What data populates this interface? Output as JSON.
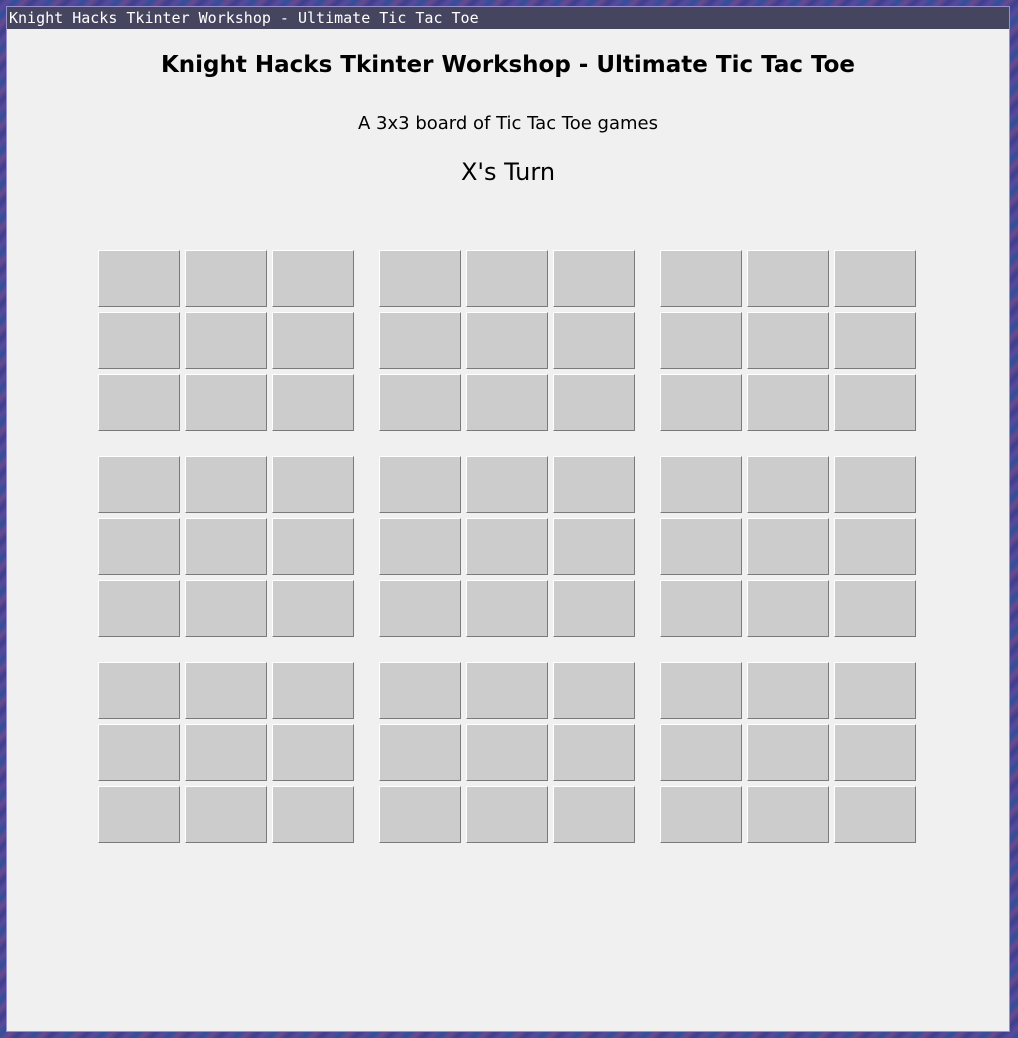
{
  "window": {
    "title": "Knight Hacks Tkinter Workshop - Ultimate Tic Tac Toe"
  },
  "header": {
    "title": "Knight Hacks Tkinter Workshop - Ultimate Tic Tac Toe",
    "subtitle": "A 3x3 board of Tic Tac Toe games",
    "turn": "X's Turn"
  },
  "board": {
    "boards": [
      [
        "",
        "",
        "",
        "",
        "",
        "",
        "",
        "",
        ""
      ],
      [
        "",
        "",
        "",
        "",
        "",
        "",
        "",
        "",
        ""
      ],
      [
        "",
        "",
        "",
        "",
        "",
        "",
        "",
        "",
        ""
      ],
      [
        "",
        "",
        "",
        "",
        "",
        "",
        "",
        "",
        ""
      ],
      [
        "",
        "",
        "",
        "",
        "",
        "",
        "",
        "",
        ""
      ],
      [
        "",
        "",
        "",
        "",
        "",
        "",
        "",
        "",
        ""
      ],
      [
        "",
        "",
        "",
        "",
        "",
        "",
        "",
        "",
        ""
      ],
      [
        "",
        "",
        "",
        "",
        "",
        "",
        "",
        "",
        ""
      ],
      [
        "",
        "",
        "",
        "",
        "",
        "",
        "",
        "",
        ""
      ]
    ]
  }
}
